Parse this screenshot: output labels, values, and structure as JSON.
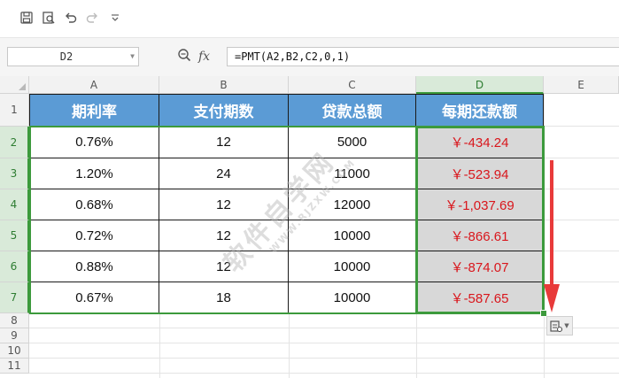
{
  "toolbar": {
    "icons": [
      "save-icon",
      "print-preview-icon",
      "undo-icon",
      "redo-icon",
      "customize-toolbar-icon"
    ]
  },
  "formula_bar": {
    "name_box": "D2",
    "fx_label": "fx",
    "formula": "=PMT(A2,B2,C2,0,1)"
  },
  "sheet": {
    "columns": [
      "A",
      "B",
      "C",
      "D",
      "E"
    ],
    "rows": [
      "1",
      "2",
      "3",
      "4",
      "5",
      "6",
      "7",
      "8",
      "9",
      "10",
      "11"
    ],
    "selected_column": "D",
    "header_row": [
      "期利率",
      "支付期数",
      "贷款总额",
      "每期还款额"
    ],
    "data": [
      [
        "0.76%",
        "12",
        "5000",
        "￥-434.24"
      ],
      [
        "1.20%",
        "24",
        "11000",
        "￥-523.94"
      ],
      [
        "0.68%",
        "12",
        "12000",
        "￥-1,037.69"
      ],
      [
        "0.72%",
        "12",
        "10000",
        "￥-866.61"
      ],
      [
        "0.88%",
        "12",
        "10000",
        "￥-874.07"
      ],
      [
        "0.67%",
        "18",
        "10000",
        "￥-587.65"
      ]
    ]
  },
  "watermark": {
    "main": "软件自学网",
    "sub": "WWW.RJZXW.COM"
  },
  "colors": {
    "header_fill": "#5b9bd5",
    "result_text": "#d9161c",
    "selection": "#3c9a3c",
    "arrow": "#e83a3a"
  }
}
